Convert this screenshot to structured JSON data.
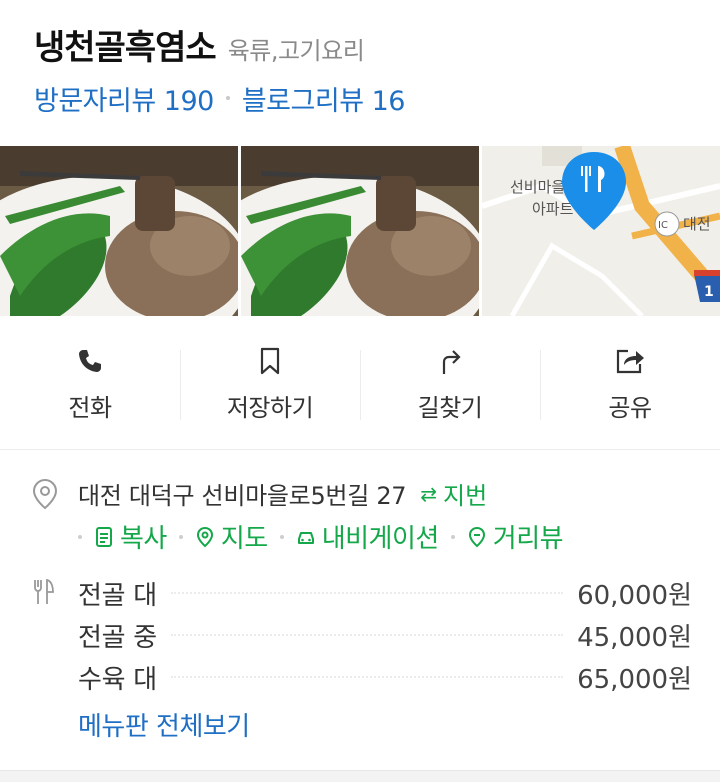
{
  "header": {
    "title": "냉천골흑염소",
    "category": "육류,고기요리",
    "visitor_reviews_label": "방문자리뷰 190",
    "blog_reviews_label": "블로그리뷰 16"
  },
  "map_preview": {
    "label_village": "선비마을",
    "label_apt": "아파트",
    "ic_badge": "IC",
    "ic_name": "대전",
    "route_number": "1"
  },
  "actions": [
    {
      "label": "전화",
      "icon": "phone-icon"
    },
    {
      "label": "저장하기",
      "icon": "bookmark-icon"
    },
    {
      "label": "길찾기",
      "icon": "directions-icon"
    },
    {
      "label": "공유",
      "icon": "share-icon"
    }
  ],
  "address": {
    "text": "대전 대덕구 선비마을로5번길 27",
    "jibun_label": "지번",
    "swap_glyph": "⇄",
    "links": [
      {
        "label": "복사",
        "icon": "copy-icon"
      },
      {
        "label": "지도",
        "icon": "map-pin-icon"
      },
      {
        "label": "내비게이션",
        "icon": "car-icon"
      },
      {
        "label": "거리뷰",
        "icon": "streetview-icon"
      }
    ]
  },
  "menu": {
    "items": [
      {
        "name": "전골 대",
        "price": "60,000원"
      },
      {
        "name": "전골 중",
        "price": "45,000원"
      },
      {
        "name": "수육 대",
        "price": "65,000원"
      }
    ],
    "view_all_label": "메뉴판 전체보기"
  },
  "colors": {
    "link_blue": "#1f6fc5",
    "action_green": "#15a84a",
    "map_pin_blue": "#1a8ee8",
    "map_road_orange": "#f2b24a"
  }
}
